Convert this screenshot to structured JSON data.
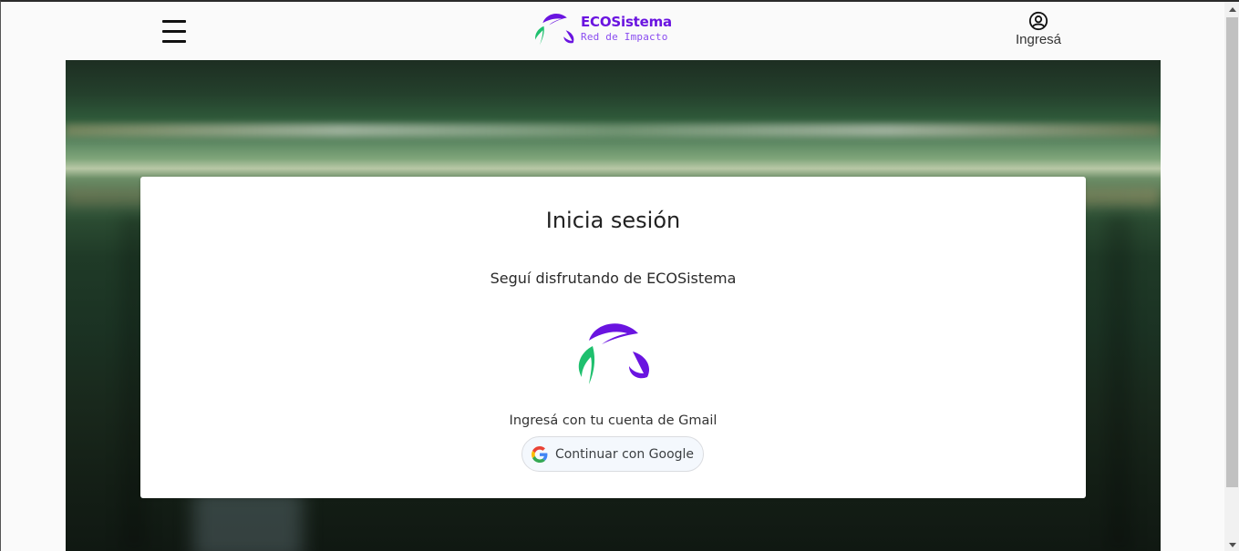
{
  "header": {
    "menu_icon": "hamburger-menu-icon",
    "logo": {
      "title": "ECOSistema",
      "subtitle": "Red de Impacto",
      "icon": "recycle-leaves-icon"
    },
    "login": {
      "icon": "user-circle-icon",
      "label": "Ingresá"
    }
  },
  "card": {
    "title": "Inicia sesión",
    "subtitle": "Seguí disfrutando de ECOSistema",
    "logo_icon": "recycle-leaves-icon",
    "gmail_prompt": "Ingresá con tu cuenta de Gmail",
    "google_button": {
      "icon": "google-g-icon",
      "label": "Continuar con Google"
    }
  },
  "colors": {
    "brand_purple": "#6a14e0",
    "brand_green": "#1fc06e"
  }
}
